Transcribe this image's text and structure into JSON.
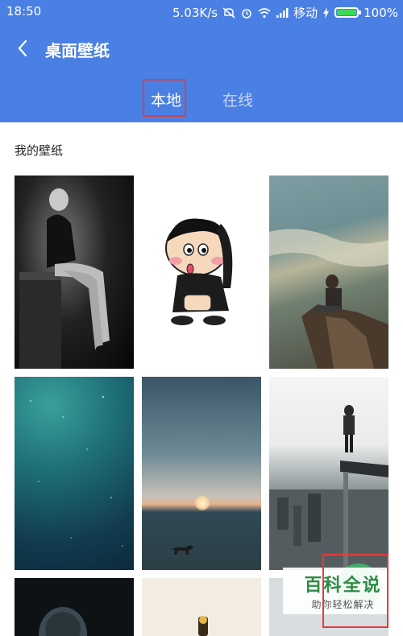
{
  "status_bar": {
    "time": "18:50",
    "network_speed": "5.03K/s",
    "carrier": "移动",
    "battery_percent": "100%",
    "battery_level": 1.0,
    "icons": [
      "mute-icon",
      "alarm-icon",
      "wifi-icon",
      "signal-icon",
      "charging-icon",
      "battery-icon"
    ]
  },
  "header": {
    "title": "桌面壁纸",
    "back_icon": "chevron-left-icon"
  },
  "tabs": [
    {
      "label": "本地",
      "selected": true
    },
    {
      "label": "在线",
      "selected": false
    }
  ],
  "section": {
    "title": "我的壁纸"
  },
  "wallpapers": [
    {
      "name": "wallpaper-woman-bw"
    },
    {
      "name": "wallpaper-crayon-shinchan"
    },
    {
      "name": "wallpaper-cliff-coast"
    },
    {
      "name": "wallpaper-teal-space"
    },
    {
      "name": "wallpaper-beach-sunset-dog"
    },
    {
      "name": "wallpaper-city-ledge"
    },
    {
      "name": "wallpaper-dark-partial"
    },
    {
      "name": "wallpaper-cartoon-partial"
    },
    {
      "name": "wallpaper-light-partial"
    }
  ],
  "watermark": {
    "main": "百科全说",
    "sub": "助你轻松解决"
  },
  "colors": {
    "header_bg": "#4a7fe3",
    "highlight_box": "#e23b3b",
    "watermark_green": "#2f8a43"
  }
}
